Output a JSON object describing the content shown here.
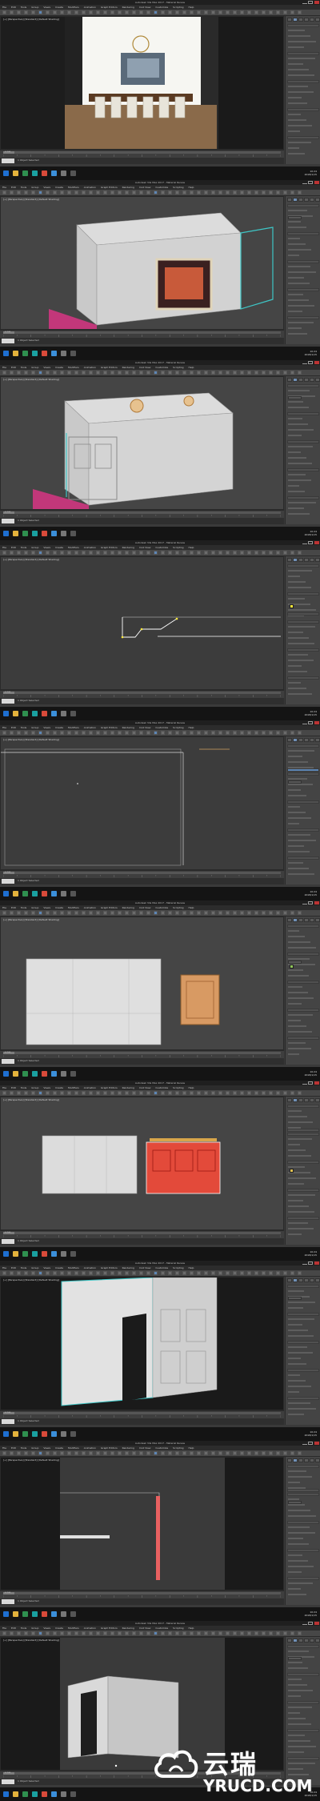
{
  "app": {
    "window_title": "Autodesk 3ds Max 2017 - Material Renew",
    "menus": [
      "File",
      "Edit",
      "Tools",
      "Group",
      "Views",
      "Create",
      "Modifiers",
      "Animation",
      "Graph Editors",
      "Rendering",
      "Civil View",
      "Customize",
      "Scripting",
      "Help"
    ],
    "viewport_label": "[+] [Perspective] [Standard] [Default Shading]",
    "frame_counter": "0 / 100",
    "status_text": "1 Object Selected",
    "status_hint": "Click and drag to select and move objects",
    "tray_time": "10:24",
    "tray_date": "2018/1/15"
  },
  "colors": {
    "window_bg": "#3a3a3a",
    "viewport_bg": "#454545",
    "dark_viewport_bg": "#3c3c3c",
    "selection": "#3ec6c6",
    "accent_blue": "#5d86b5",
    "pink_floor": "#c2377a",
    "red_mesh": "#e34a3a",
    "wood": "#d89a63"
  },
  "icons": [
    "window-minimize-icon",
    "window-maximize-icon",
    "window-close-icon",
    "select-icon",
    "move-icon",
    "rotate-icon",
    "scale-icon",
    "render-icon",
    "start-icon",
    "folder-icon",
    "browser-icon",
    "3dsmax-icon",
    "cloud-icon"
  ],
  "watermark": {
    "cn": "云瑞",
    "en": "YRUCD.COM"
  }
}
